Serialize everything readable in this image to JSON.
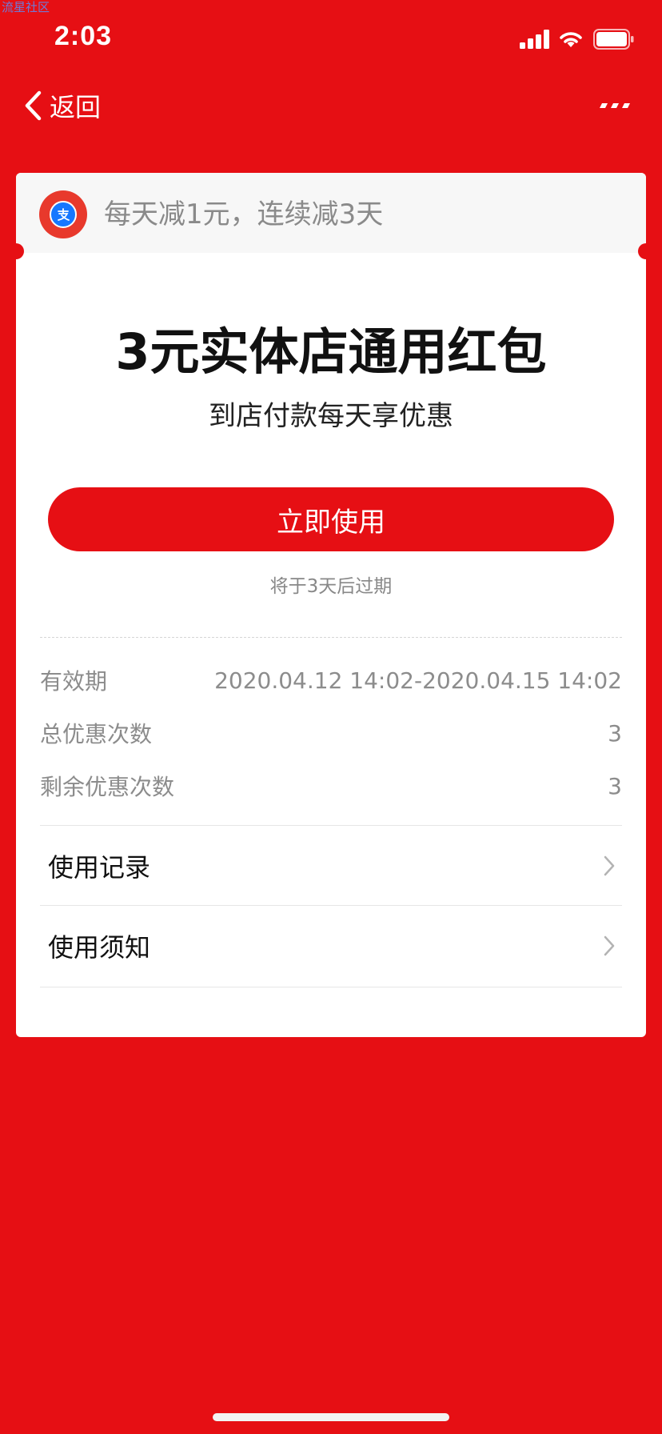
{
  "watermark": "流星社区",
  "status_bar": {
    "time": "2:03"
  },
  "nav": {
    "back_label": "返回"
  },
  "card": {
    "header_text": "每天减1元，连续减3天",
    "title": "3元实体店通用红包",
    "subtitle": "到店付款每天享优惠",
    "use_button_label": "立即使用",
    "expire_note": "将于3天后过期",
    "info": [
      {
        "label": "有效期",
        "value": "2020.04.12 14:02-2020.04.15 14:02"
      },
      {
        "label": "总优惠次数",
        "value": "3"
      },
      {
        "label": "剩余优惠次数",
        "value": "3"
      }
    ],
    "links": [
      {
        "label": "使用记录"
      },
      {
        "label": "使用须知"
      }
    ]
  },
  "colors": {
    "brand_red": "#e60f14",
    "card_bg": "#ffffff",
    "header_bg": "#f7f7f7",
    "alipay_blue": "#1677ff"
  },
  "icons": {
    "back": "chevron-left-icon",
    "more": "more-dots-icon",
    "signal": "signal-icon",
    "wifi": "wifi-icon",
    "battery": "battery-icon",
    "logo": "alipay-logo-icon",
    "chevron": "chevron-right-icon"
  }
}
